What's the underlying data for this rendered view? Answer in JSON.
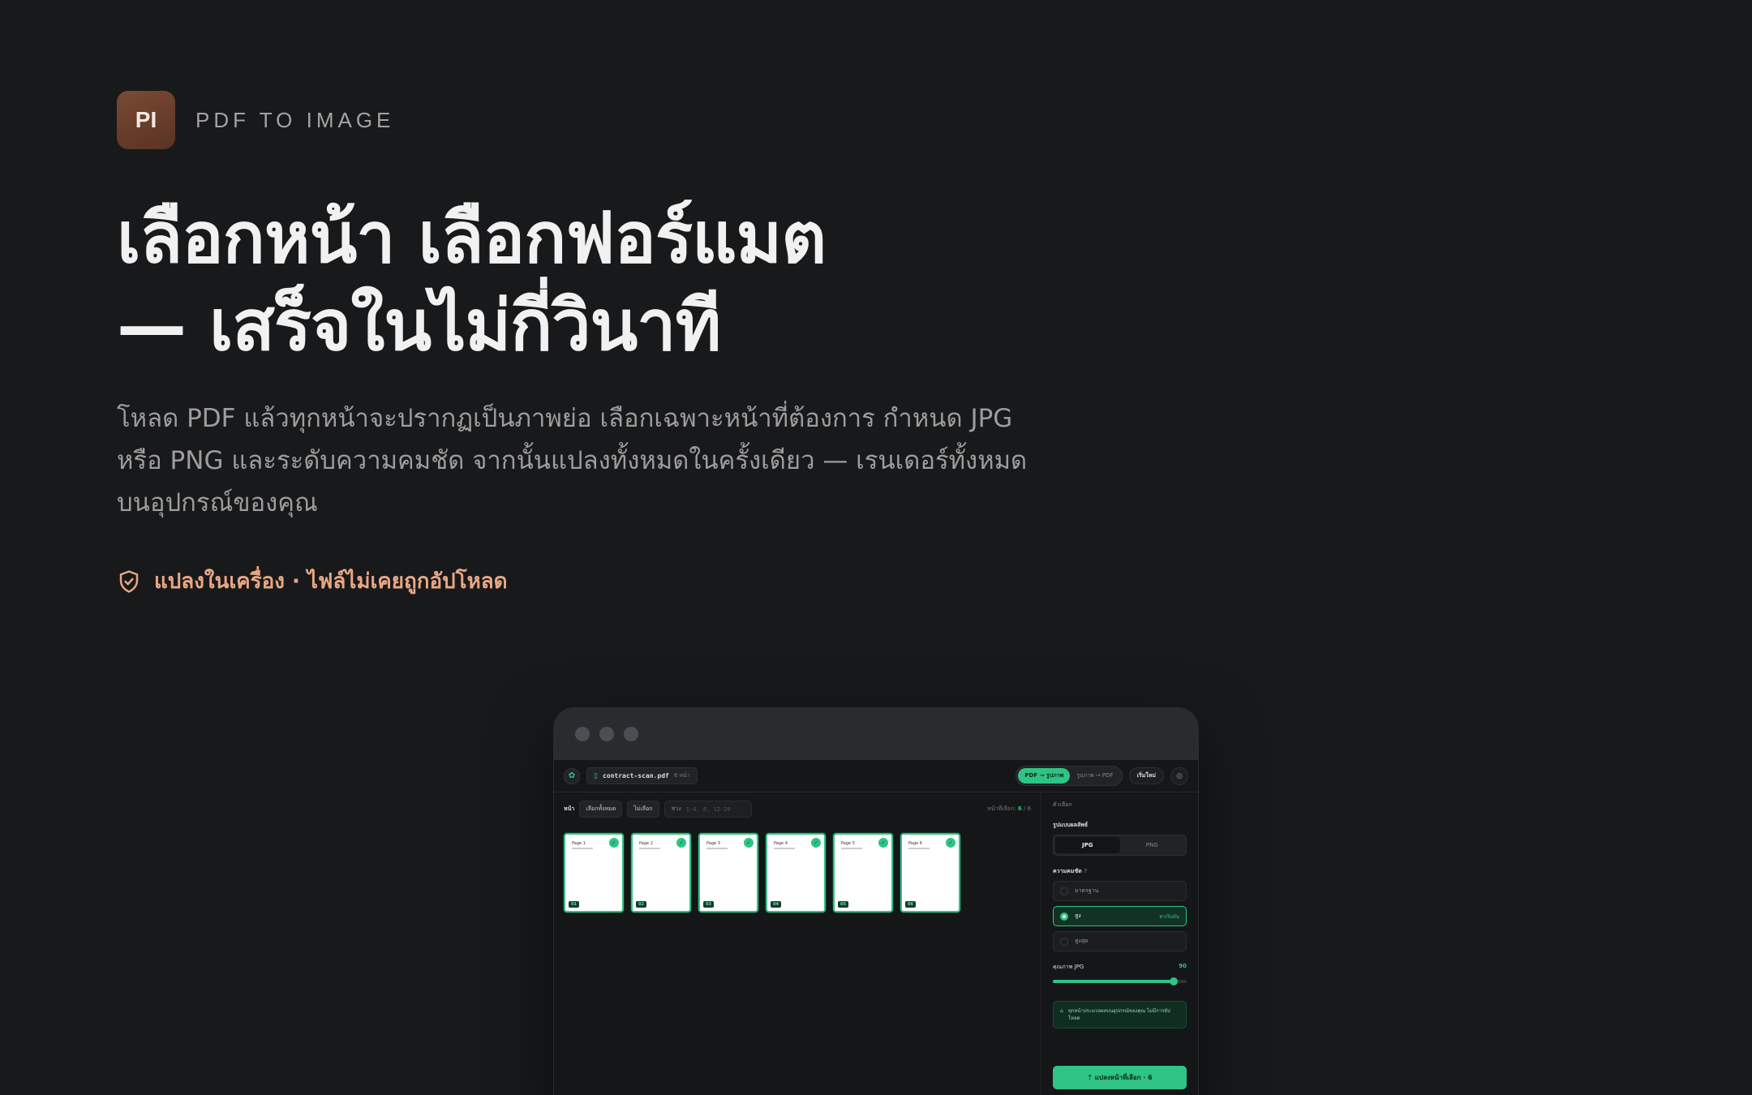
{
  "brand": {
    "logo_text": "PI",
    "name": "PDF TO IMAGE"
  },
  "hero": {
    "line1": "เลือกหน้า เลือกฟอร์แมต",
    "line2": "— เสร็จในไม่กี่วินาที",
    "lead": "โหลด PDF แล้วทุกหน้าจะปรากฏเป็นภาพย่อ เลือกเฉพาะหน้าที่ต้องการ กำหนด JPG หรือ PNG และระดับความคมชัด จากนั้นแปลงทั้งหมดในครั้งเดียว — เรนเดอร์ทั้งหมดบนอุปกรณ์ของคุณ",
    "privacy": "แปลงในเครื่อง · ไฟล์ไม่เคยถูกอัปโหลด"
  },
  "app": {
    "file_name": "contract-scan.pdf",
    "file_pages": "6 หน้า",
    "mode_pdf_to_image": "PDF → รูปภาพ",
    "mode_image_to_pdf": "รูปภาพ → PDF",
    "new_label": "เริ่มใหม่",
    "toolbar": {
      "pages_label": "หน้า",
      "select_all": "เลือกทั้งหมด",
      "deselect": "ไม่เลือก",
      "range_label": "ช่วง",
      "range_placeholder": "1-4, 8, 12-20",
      "selected_label": "หน้าที่เลือก:",
      "selected_count": "6",
      "total_count": "/ 6"
    },
    "pages": [
      {
        "title": "Page 1",
        "num": "01"
      },
      {
        "title": "Page 2",
        "num": "02"
      },
      {
        "title": "Page 3",
        "num": "03"
      },
      {
        "title": "Page 4",
        "num": "04"
      },
      {
        "title": "Page 5",
        "num": "05"
      },
      {
        "title": "Page 6",
        "num": "06"
      }
    ],
    "options": {
      "heading": "ตัวเลือก",
      "format_label": "รูปแบบผลลัพธ์",
      "format_jpg": "JPG",
      "format_png": "PNG",
      "resolution_label": "ความคมชัด",
      "res_standard": "มาตรฐาน",
      "res_high": "สูง",
      "res_recommended": "ค่าเริ่มต้น",
      "res_max": "สูงสุด",
      "quality_label": "คุณภาพ JPG",
      "quality_value": "90",
      "quality_fraction": 0.9,
      "note": "ทุกหน้าประมวลผลบนอุปกรณ์ของคุณ ไม่มีการอัปโหลด",
      "convert_label": "แปลงหน้าที่เลือก · 6"
    }
  },
  "colors": {
    "accent": "#2fc385",
    "privacy": "#e8a784",
    "background": "#18191b"
  }
}
